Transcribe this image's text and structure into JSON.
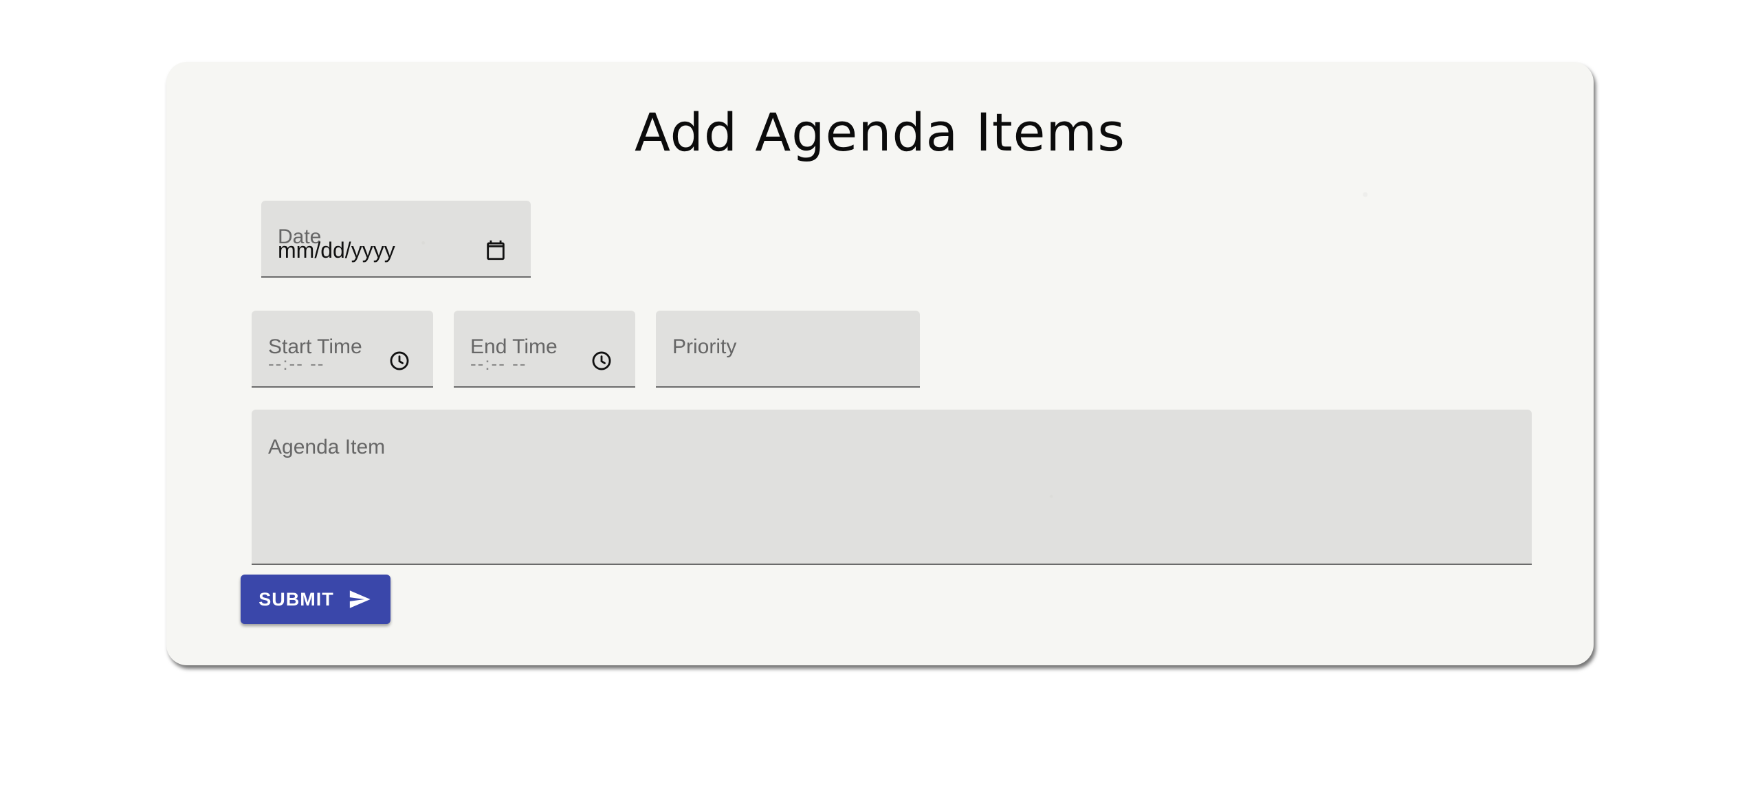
{
  "form": {
    "title": "Add Agenda Items",
    "date": {
      "label": "Date",
      "value": "mm/dd/yyyy",
      "icon": "calendar-icon"
    },
    "start_time": {
      "label": "Start Time",
      "value": "--:-- --",
      "icon": "clock-icon"
    },
    "end_time": {
      "label": "End Time",
      "value": "--:-- --",
      "icon": "clock-icon"
    },
    "priority": {
      "label": "Priority",
      "value": ""
    },
    "agenda_item": {
      "label": "Agenda Item",
      "value": ""
    },
    "submit": {
      "label": "SUBMIT",
      "icon": "send-icon"
    }
  },
  "colors": {
    "page_background": "#ffffff",
    "card_background": "#f6f6f3",
    "field_background": "#e2e2e0",
    "field_underline": "#6b6b6b",
    "button_primary": "#3a47aa",
    "button_text": "#ffffff"
  }
}
